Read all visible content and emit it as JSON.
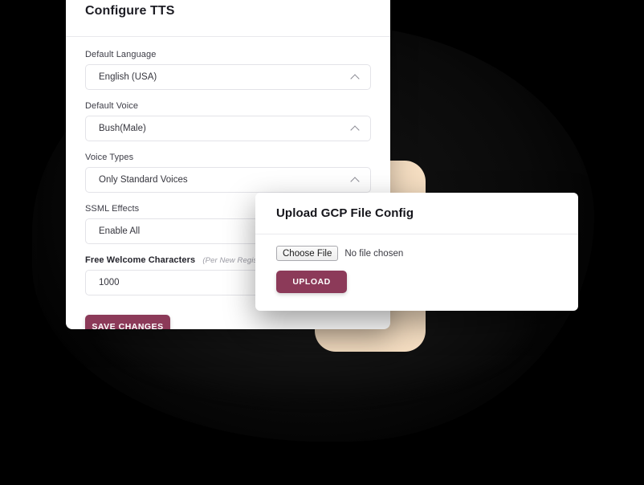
{
  "theme": {
    "accent": "#8c3a59",
    "panel_bg": "#ffffff",
    "page_bg": "#000000",
    "beige": "#f5dec2",
    "border": "#e3e3e8"
  },
  "panel": {
    "title": "Configure TTS",
    "fields": [
      {
        "label": "Default Language",
        "value": "English (USA)",
        "control": "select",
        "icon": "chevron-up-icon"
      },
      {
        "label": "Default Voice",
        "value": "Bush(Male)",
        "control": "select",
        "icon": "chevron-up-icon"
      },
      {
        "label": "Voice Types",
        "value": "Only Standard Voices",
        "control": "select",
        "icon": "chevron-up-icon"
      },
      {
        "label": "SSML Effects",
        "value": "Enable All",
        "control": "select",
        "icon": "chevron-up-icon"
      },
      {
        "label": "Free Welcome Characters",
        "hint": "(Per New Registered User)",
        "value": "1000",
        "control": "text"
      }
    ],
    "save_label": "SAVE CHANGES"
  },
  "dialog": {
    "title": "Upload GCP File Config",
    "choose_file_label": "Choose File",
    "file_status": "No file chosen",
    "upload_label": "UPLOAD"
  }
}
